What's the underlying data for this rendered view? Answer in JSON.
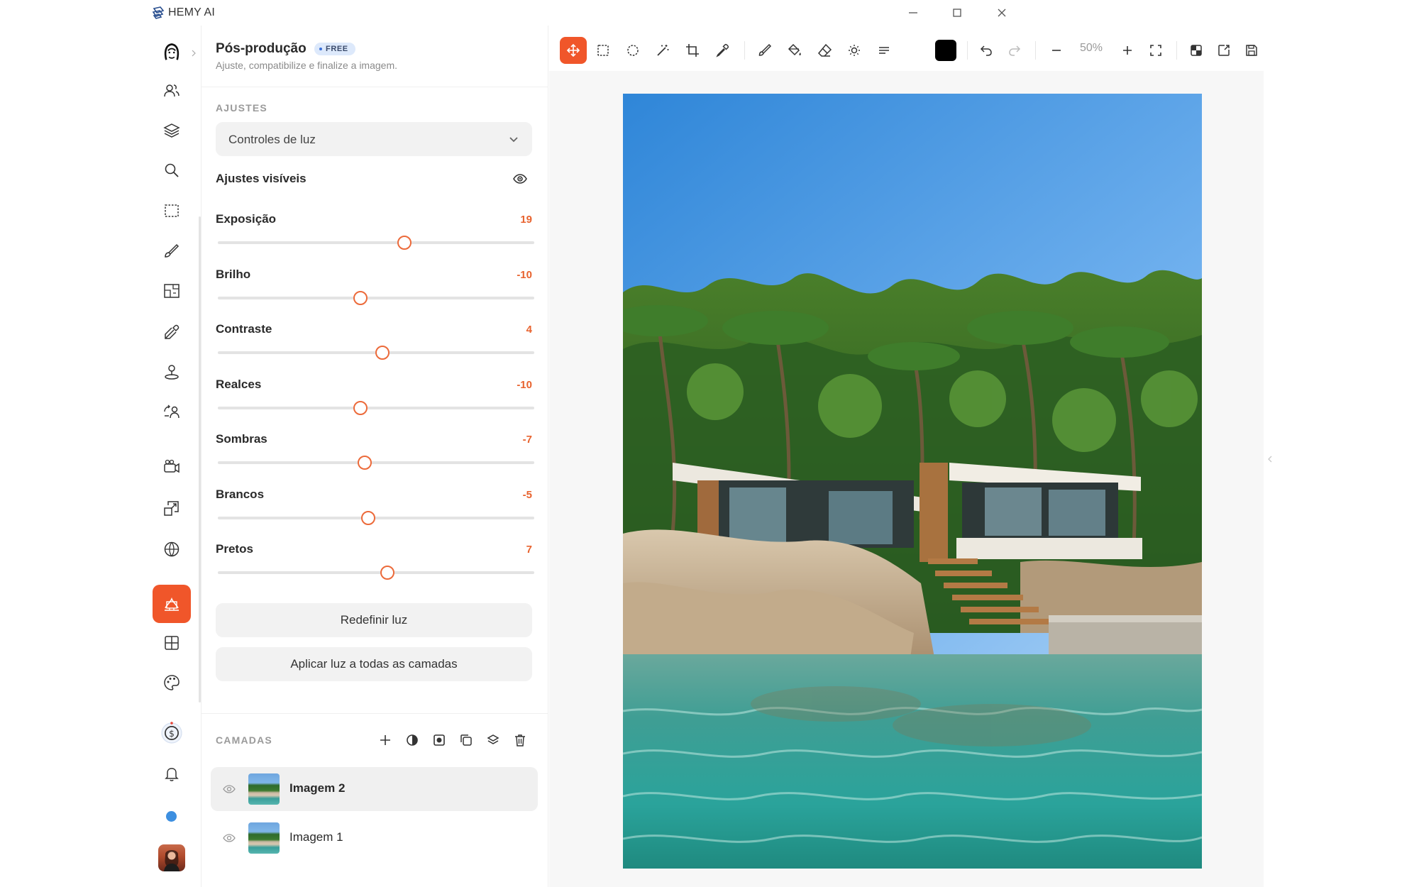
{
  "app": {
    "title": "HEMY AI"
  },
  "panel": {
    "title": "Pós-produção",
    "badge": "FREE",
    "subtitle": "Ajuste, compatibilize e finalize a imagem."
  },
  "adjustments": {
    "section_label": "AJUSTES",
    "preset": "Controles de luz",
    "visible_label": "Ajustes visíveis",
    "sliders": [
      {
        "label": "Exposição",
        "value": "19",
        "fraction": 0.59
      },
      {
        "label": "Brilho",
        "value": "-10",
        "fraction": 0.45
      },
      {
        "label": "Contraste",
        "value": "4",
        "fraction": 0.52
      },
      {
        "label": "Realces",
        "value": "-10",
        "fraction": 0.45
      },
      {
        "label": "Sombras",
        "value": "-7",
        "fraction": 0.465
      },
      {
        "label": "Brancos",
        "value": "-5",
        "fraction": 0.475
      },
      {
        "label": "Pretos",
        "value": "7",
        "fraction": 0.535
      }
    ],
    "reset_button": "Redefinir luz",
    "apply_all_button": "Aplicar luz a todas as camadas"
  },
  "layers": {
    "section_label": "CAMADAS",
    "items": [
      {
        "name": "Imagem 2",
        "active": true
      },
      {
        "name": "Imagem 1",
        "active": false
      }
    ]
  },
  "toolbar": {
    "zoom": "50%",
    "active_tool": "move-tool",
    "current_color": "#000000"
  },
  "colors": {
    "accent": "#f0562a",
    "slider_value": "#e8632f"
  }
}
